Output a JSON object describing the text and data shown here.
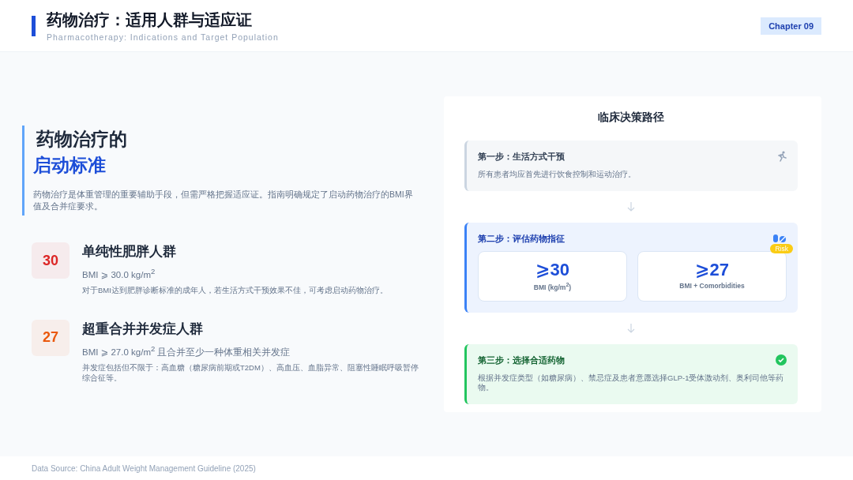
{
  "header": {
    "title": "药物治疗：适用人群与适应证",
    "subtitle": "Pharmacotherapy: Indications and Target Population",
    "chapter": "Chapter 09"
  },
  "intro": {
    "title_line_1": "药物治疗的",
    "title_line_2": "启动标准",
    "text": "药物治疗是体重管理的重要辅助手段，但需严格把握适应证。指南明确规定了启动药物治疗的BMI界值及合并症要求。"
  },
  "criteria": [
    {
      "number": "30",
      "color": "#dc2626",
      "title": "单纯性肥胖人群",
      "rule": "BMI ⩾ 30.0 kg/m$^{2}$",
      "note": "对于BMI达到肥胖诊断标准的成年人，若生活方式干预效果不佳，可考虑启动药物治疗。"
    },
    {
      "number": "27",
      "color": "#ea580c",
      "title": "超重合并并发症人群",
      "rule": "BMI ⩾ 27.0 kg/m$^{2}$ 且合并至少一种体重相关并发症",
      "note": "并发症包括但不限于：高血糖（糖尿病前期或T2DM）、高血压、血脂异常、阻塞性睡眠呼吸暂停综合征等。"
    }
  ],
  "pathway": {
    "title": "临床决策路径",
    "steps": [
      {
        "kind": "lifestyle",
        "color": "#cbd5e1",
        "title": "第一步：生活方式干预",
        "text": "所有患者均应首先进行饮食控制和运动治疗。"
      },
      {
        "kind": "evaluate",
        "color": "#3b82f6",
        "title": "第二步：评估药物指征",
        "badge": "Risk",
        "metrics": [
          {
            "value": "⩾30",
            "label": "BMI (kg/m$^{2}$)"
          },
          {
            "value": "⩾27",
            "label": "BMI + Comorbidities"
          }
        ]
      },
      {
        "kind": "choose",
        "color": "#22c55e",
        "title": "第三步：选择合适药物",
        "text": "根据并发症类型（如糖尿病）、禁忌症及患者意愿选择GLP-1受体激动剂、奥利司他等药物。"
      }
    ]
  },
  "footer": {
    "source": "Data Source: China Adult Weight Management Guideline (2025)"
  }
}
